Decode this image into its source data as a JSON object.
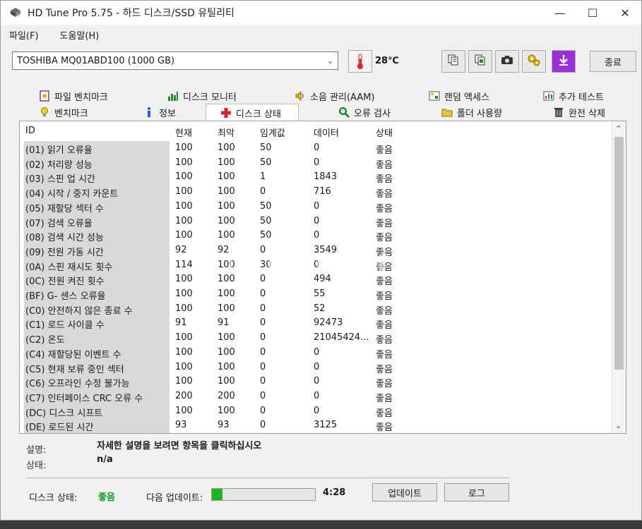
{
  "window": {
    "title": "HD Tune Pro 5.75 - 하드 디스크/SSD 유틸리티",
    "controls": {
      "minimize": "—",
      "maximize": "☐",
      "close": "✕"
    }
  },
  "menu": {
    "items": [
      "파일(F)",
      "도움말(H)"
    ]
  },
  "toolbar": {
    "drive": "TOSHIBA MQ01ABD100 (1000 GB)",
    "temperature": "28℃",
    "exit_label": "종료",
    "icons": [
      "copy-icon",
      "copy-screenshot-icon",
      "camera-icon",
      "options-icon",
      "save-icon"
    ]
  },
  "tabs": {
    "row1": [
      "파일 벤치마크",
      "디스크 모니터",
      "소음 관리(AAM)",
      "랜덤 액세스",
      "추가 테스트"
    ],
    "row2": [
      "벤치마크",
      "정보",
      "디스크 상태",
      "오류 검사",
      "폴더 사용량",
      "완전 삭제"
    ],
    "active": "디스크 상태"
  },
  "table": {
    "headers": [
      "ID",
      "현재",
      "최악",
      "임계값",
      "데이터",
      "상태"
    ],
    "rows": [
      [
        "(01) 읽기 오류율",
        "100",
        "100",
        "50",
        "0",
        "좋음"
      ],
      [
        "(02) 처리량 성능",
        "100",
        "100",
        "50",
        "0",
        "좋음"
      ],
      [
        "(03) 스핀 업 시간",
        "100",
        "100",
        "1",
        "1843",
        "좋음"
      ],
      [
        "(04) 시작 / 중지 카운트",
        "100",
        "100",
        "0",
        "716",
        "좋음"
      ],
      [
        "(05) 재할당 섹터 수",
        "100",
        "100",
        "50",
        "0",
        "좋음"
      ],
      [
        "(07) 검색 오류율",
        "100",
        "100",
        "50",
        "0",
        "좋음"
      ],
      [
        "(08) 검색 시간 성능",
        "100",
        "100",
        "50",
        "0",
        "좋음"
      ],
      [
        "(09) 전원 가동 시간",
        "92",
        "92",
        "0",
        "3549",
        "좋음"
      ],
      [
        "(0A) 스핀 재시도 횟수",
        "114",
        "100",
        "30",
        "0",
        "좋음"
      ],
      [
        "(0C) 전원 켜진 횟수",
        "100",
        "100",
        "0",
        "494",
        "좋음"
      ],
      [
        "(BF) G- 센스 오류율",
        "100",
        "100",
        "0",
        "55",
        "좋음"
      ],
      [
        "(C0) 안전하지 않은 종료 수",
        "100",
        "100",
        "0",
        "52",
        "좋음"
      ],
      [
        "(C1) 로드 사이클 수",
        "91",
        "91",
        "0",
        "92473",
        "좋음"
      ],
      [
        "(C2) 온도",
        "100",
        "100",
        "0",
        "21045424...",
        "좋음"
      ],
      [
        "(C4) 재할당된 이벤트 수",
        "100",
        "100",
        "0",
        "0",
        "좋음"
      ],
      [
        "(C5) 현재 보류 중인 섹터",
        "100",
        "100",
        "0",
        "0",
        "좋음"
      ],
      [
        "(C6) 오프라인 수정 불가능",
        "100",
        "100",
        "0",
        "0",
        "좋음"
      ],
      [
        "(C7) 인터페이스 CRC 오류 수",
        "200",
        "200",
        "0",
        "0",
        "좋음"
      ],
      [
        "(DC) 디스크 시프트",
        "100",
        "100",
        "0",
        "0",
        "좋음"
      ],
      [
        "(DE) 로드된 시간",
        "93",
        "93",
        "0",
        "3125",
        "좋음"
      ]
    ]
  },
  "info": {
    "description_label": "설명:",
    "description_value": "자세한 설명을 보려면 항목을 클릭하십시오",
    "status_label": "상태:",
    "status_value": "n/a"
  },
  "footer": {
    "disk_state_label": "디스크 상태:",
    "disk_state_value": "좋음",
    "next_update_label": "다음 업데이트:",
    "progress": 0.1,
    "countdown": "4:28",
    "update_label": "업데이트",
    "log_label": "로그"
  },
  "watermark": "Joonggonara",
  "colors": {
    "good": "#0a9a1a",
    "progress": "#1fb31f",
    "accent_red": "#d9262b"
  }
}
